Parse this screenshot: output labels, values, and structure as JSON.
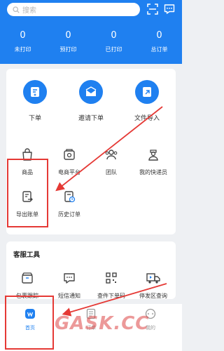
{
  "header": {
    "search_placeholder": "搜索",
    "stats": [
      {
        "value": "0",
        "label": "未打印"
      },
      {
        "value": "0",
        "label": "预打印"
      },
      {
        "value": "0",
        "label": "已打印"
      },
      {
        "value": "0",
        "label": "总订单"
      }
    ]
  },
  "main_actions": [
    {
      "label": "下单"
    },
    {
      "label": "邀请下单"
    },
    {
      "label": "文件导入"
    }
  ],
  "grid": [
    {
      "label": "商品"
    },
    {
      "label": "电商平台"
    },
    {
      "label": "团队"
    },
    {
      "label": "我的快递员"
    },
    {
      "label": "导出账单"
    },
    {
      "label": "历史订单"
    }
  ],
  "service_tools": {
    "title": "客服工具",
    "items": [
      {
        "label": "包裹跟踪"
      },
      {
        "label": "短信通知"
      },
      {
        "label": "查件下单码"
      },
      {
        "label": "停发区查询"
      }
    ]
  },
  "tabbar": [
    {
      "label": "首页"
    },
    {
      "label": "订单"
    },
    {
      "label": "我的"
    }
  ],
  "watermark": "GASK.CC",
  "colors": {
    "primary": "#1f80f0",
    "annotation_red": "#e53935"
  }
}
